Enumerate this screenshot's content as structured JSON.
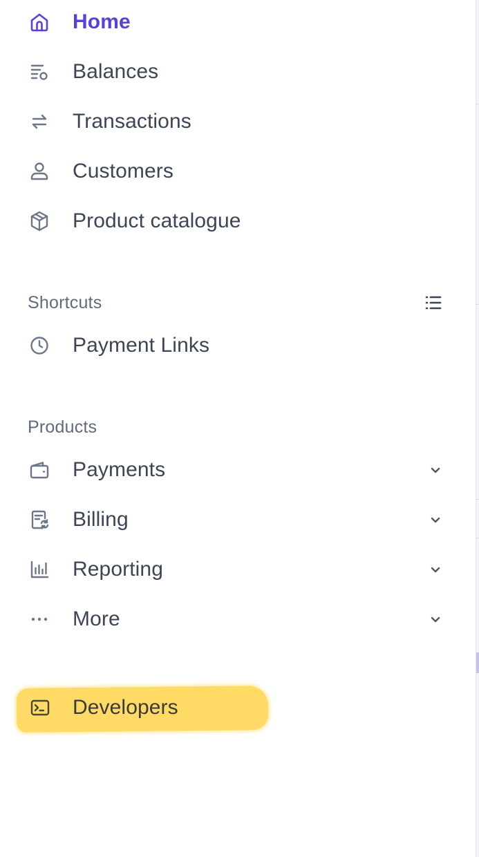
{
  "nav": {
    "home": "Home",
    "balances": "Balances",
    "transactions": "Transactions",
    "customers": "Customers",
    "product_catalogue": "Product catalogue"
  },
  "shortcuts": {
    "title": "Shortcuts",
    "items": {
      "payment_links": "Payment Links"
    }
  },
  "products": {
    "title": "Products",
    "items": {
      "payments": "Payments",
      "billing": "Billing",
      "reporting": "Reporting",
      "more": "More"
    }
  },
  "developers": "Developers",
  "colors": {
    "active": "#5a3fe0",
    "text": "#3b4556",
    "icon": "#6b7689",
    "section": "#5f6b7d",
    "highlight": "#ffd95c"
  },
  "icons": {
    "home": "home-icon",
    "balances": "balances-icon",
    "transactions": "transactions-icon",
    "customers": "user-icon",
    "product_catalogue": "box-icon",
    "shortcuts_manage": "list-icon",
    "payment_links": "clock-icon",
    "payments": "wallet-icon",
    "billing": "invoice-icon",
    "reporting": "bar-chart-icon",
    "more": "more-icon",
    "developers": "terminal-icon"
  }
}
